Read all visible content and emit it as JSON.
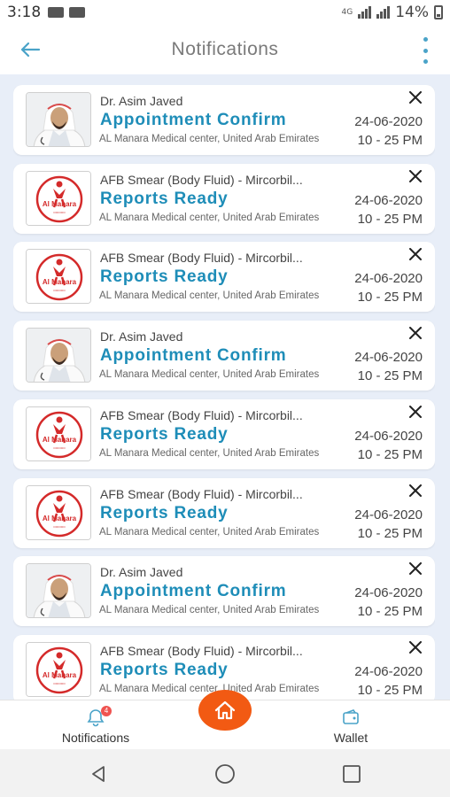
{
  "status_bar": {
    "time": "3:18",
    "network": "4G",
    "battery": "14%"
  },
  "header": {
    "title": "Notifications"
  },
  "notifications": [
    {
      "type": "doctor",
      "sender": "Dr. Asim Javed",
      "title": "Appointment Confirm",
      "location": "AL Manara Medical center, United Arab Emirates",
      "date": "24-06-2020",
      "time": "10 - 25 PM"
    },
    {
      "type": "report",
      "sender": "AFB Smear (Body Fluid) - Mircorbil...",
      "title": "Reports Ready",
      "location": "AL Manara Medical center, United Arab Emirates",
      "date": "24-06-2020",
      "time": "10 - 25 PM"
    },
    {
      "type": "report",
      "sender": "AFB Smear (Body Fluid) - Mircorbil...",
      "title": "Reports Ready",
      "location": "AL Manara Medical center, United Arab Emirates",
      "date": "24-06-2020",
      "time": "10 - 25 PM"
    },
    {
      "type": "doctor",
      "sender": "Dr. Asim Javed",
      "title": "Appointment Confirm",
      "location": "AL Manara Medical center, United Arab Emirates",
      "date": "24-06-2020",
      "time": "10 - 25 PM"
    },
    {
      "type": "report",
      "sender": "AFB Smear (Body Fluid) - Mircorbil...",
      "title": "Reports Ready",
      "location": "AL Manara Medical center, United Arab Emirates",
      "date": "24-06-2020",
      "time": "10 - 25 PM"
    },
    {
      "type": "report",
      "sender": "AFB Smear (Body Fluid) - Mircorbil...",
      "title": "Reports Ready",
      "location": "AL Manara Medical center, United Arab Emirates",
      "date": "24-06-2020",
      "time": "10 - 25 PM"
    },
    {
      "type": "doctor",
      "sender": "Dr. Asim Javed",
      "title": "Appointment Confirm",
      "location": "AL Manara Medical center, United Arab Emirates",
      "date": "24-06-2020",
      "time": "10 - 25 PM"
    },
    {
      "type": "report",
      "sender": "AFB Smear (Body Fluid) - Mircorbil...",
      "title": "Reports Ready",
      "location": "AL Manara Medical center, United Arab Emirates",
      "date": "24-06-2020",
      "time": "10 - 25 PM"
    }
  ],
  "logo": {
    "text": "Al Manara"
  },
  "bottom_nav": {
    "notifications_label": "Notifications",
    "notifications_badge": "4",
    "wallet_label": "Wallet",
    "home_icon": "home-icon"
  },
  "colors": {
    "accent": "#1e8db8",
    "fab": "#f25a13",
    "background": "#e8eef8",
    "badge": "#ef5350"
  }
}
